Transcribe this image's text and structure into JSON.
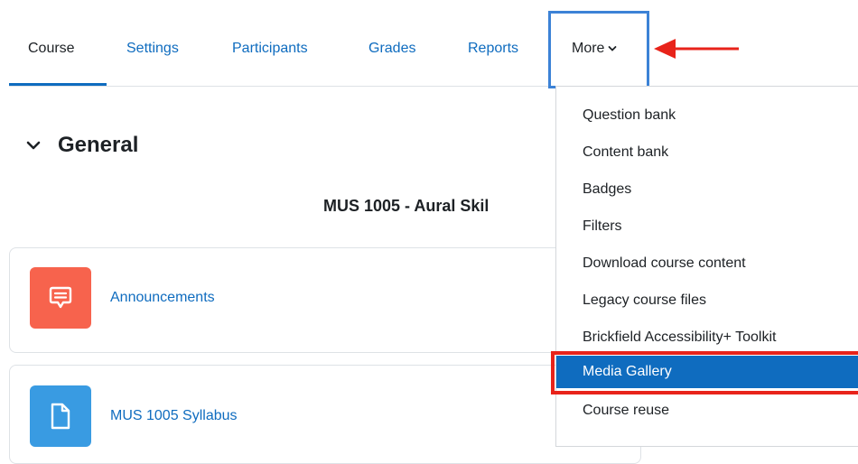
{
  "nav": {
    "tabs": [
      {
        "label": "Course"
      },
      {
        "label": "Settings"
      },
      {
        "label": "Participants"
      },
      {
        "label": "Grades"
      },
      {
        "label": "Reports"
      }
    ],
    "more_label": "More",
    "active_tab": "Course"
  },
  "section": {
    "title": "General",
    "course_name": "MUS 1005 - Aural Skil"
  },
  "activities": [
    {
      "label": "Announcements",
      "icon": "forum-icon",
      "color": "#f7634d"
    },
    {
      "label": "MUS 1005 Syllabus",
      "icon": "file-icon",
      "color": "#399be2"
    }
  ],
  "more_menu": {
    "items": [
      {
        "label": "Question bank"
      },
      {
        "label": "Content bank"
      },
      {
        "label": "Badges"
      },
      {
        "label": "Filters"
      },
      {
        "label": "Download course content"
      },
      {
        "label": "Legacy course files"
      },
      {
        "label": "Brickfield Accessibility+ Toolkit"
      },
      {
        "label": "Media Gallery"
      },
      {
        "label": "Course reuse"
      }
    ],
    "selected": "Media Gallery"
  },
  "colors": {
    "link": "#0f6cbf",
    "annotation_red": "#e8231a",
    "annotation_blue": "#3c82d6",
    "selected_bg": "#0f6cbf"
  }
}
